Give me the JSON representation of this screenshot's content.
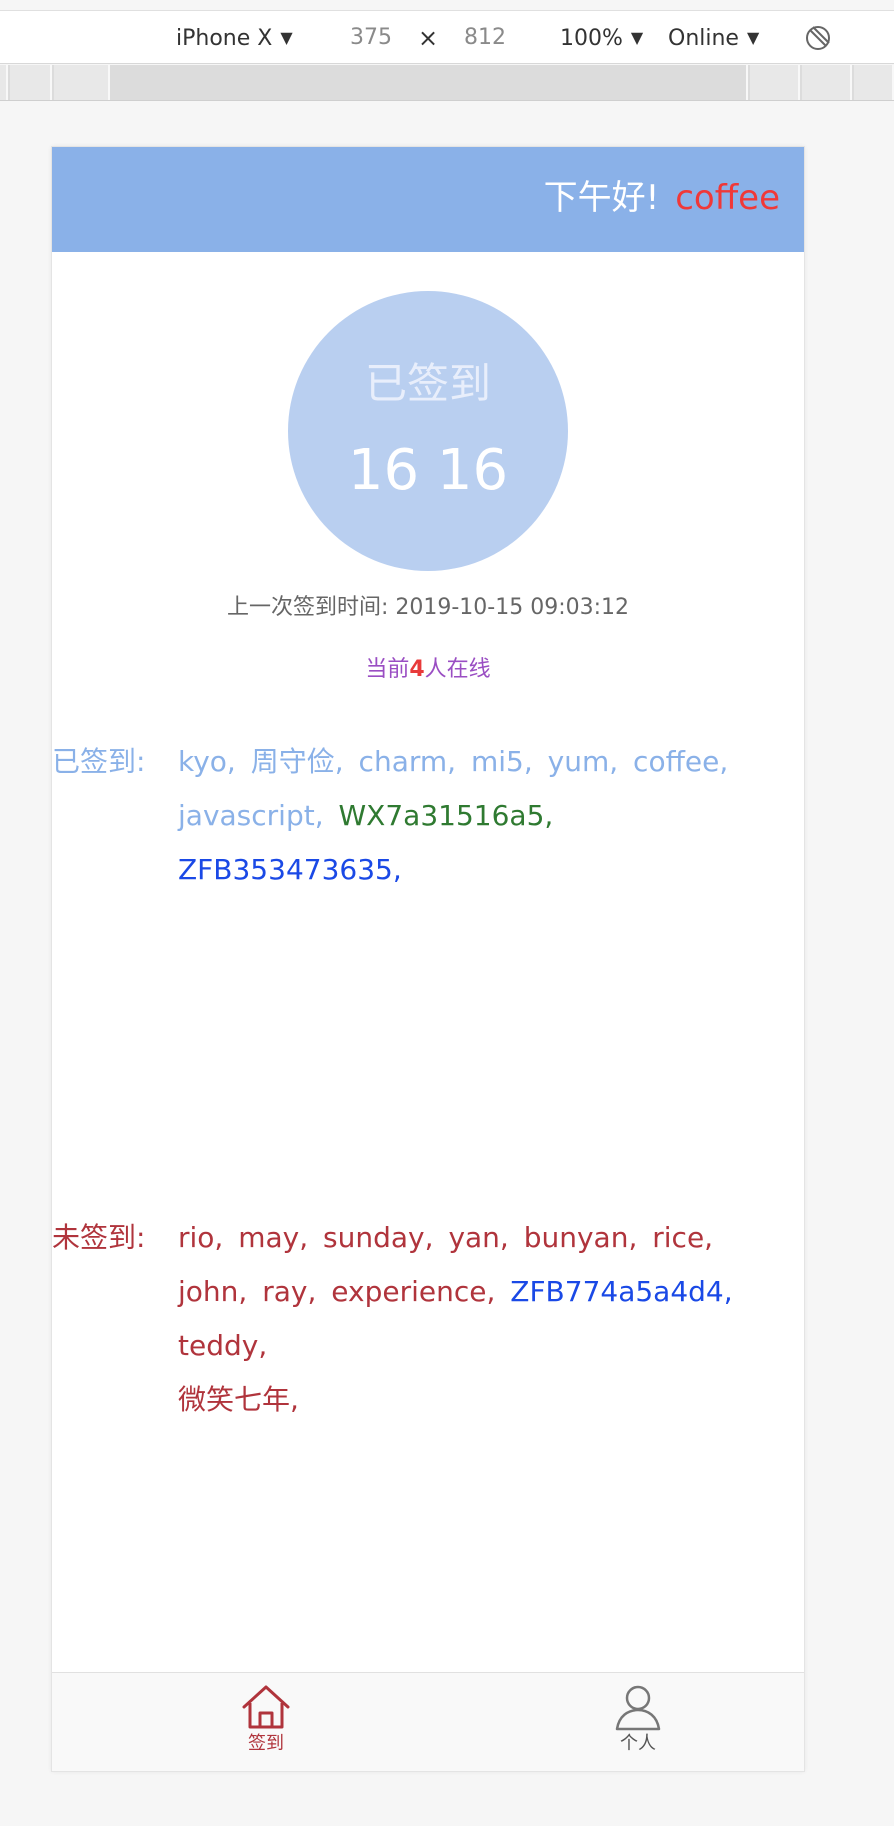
{
  "devtools": {
    "device": "iPhone X",
    "width": "375",
    "times": "×",
    "height": "812",
    "zoom": "100%",
    "network": "Online",
    "caret": "▼"
  },
  "header": {
    "greeting": "下午好!",
    "username": "coffee"
  },
  "sign": {
    "status": "已签到",
    "count": "16 16"
  },
  "last_sign": {
    "label": "上一次签到时间:",
    "time": "2019-10-15 09:03:12"
  },
  "online": {
    "prefix": "当前",
    "count": "4",
    "suffix": "人在线"
  },
  "signed": {
    "label": "已签到:",
    "names": [
      "kyo,",
      "周守俭,",
      "charm,",
      "mi5,",
      "yum,",
      "coffee,",
      "javascript,",
      "WX7a31516a5,",
      "ZFB353473635,"
    ]
  },
  "unsigned": {
    "label": "未签到:",
    "names": [
      "rio,",
      "may,",
      "sunday,",
      "yan,",
      "bunyan,",
      "rice,",
      "john,",
      "ray,",
      "experience,",
      "ZFB774a5a4d4,",
      "teddy,",
      "微笑七年,"
    ]
  },
  "tabs": [
    {
      "label": "签到",
      "icon": "home-icon"
    },
    {
      "label": "个人",
      "icon": "user-icon"
    }
  ],
  "colors": {
    "header_bg": "#8ab1e8",
    "circle_bg": "#b9cff0",
    "username": "#f03838",
    "signed_text": "#8ab1e8",
    "unsigned_text": "#b0343c",
    "wx_name": "#2f7a31",
    "zfb_name": "#1a49e6",
    "online_text": "#9a4ec3"
  }
}
